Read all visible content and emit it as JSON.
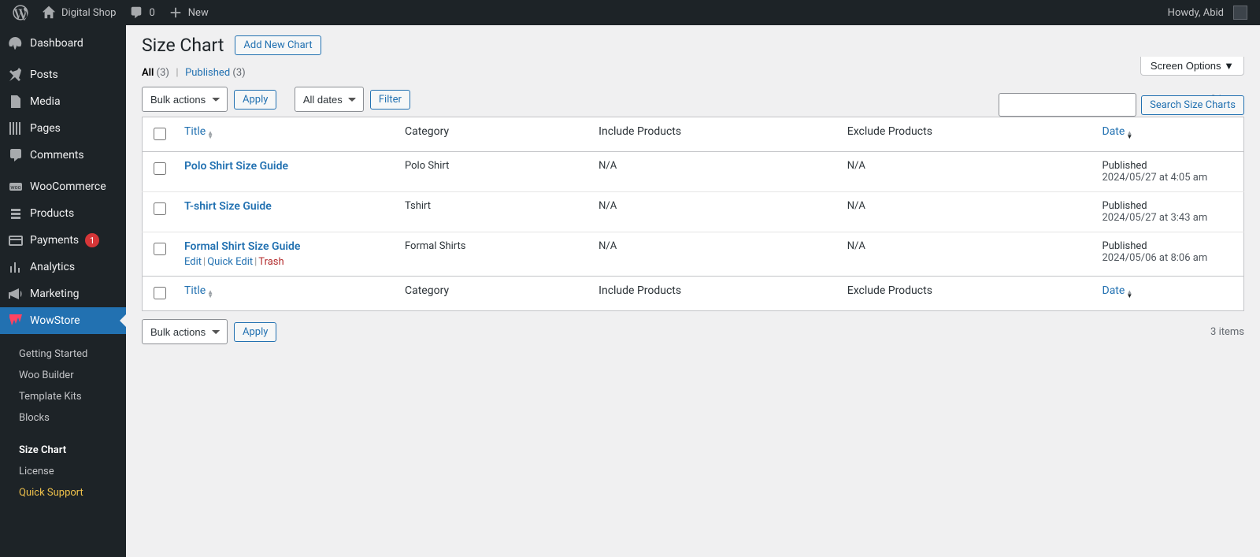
{
  "adminbar": {
    "site_name": "Digital Shop",
    "comments_count": "0",
    "new_label": "New",
    "howdy_label": "Howdy, Abid"
  },
  "sidebar": {
    "items": [
      {
        "icon": "dashboard",
        "label": "Dashboard"
      },
      {
        "icon": "pin",
        "label": "Posts"
      },
      {
        "icon": "media",
        "label": "Media"
      },
      {
        "icon": "page",
        "label": "Pages"
      },
      {
        "icon": "comment",
        "label": "Comments"
      },
      {
        "icon": "woo",
        "label": "WooCommerce"
      },
      {
        "icon": "products",
        "label": "Products"
      },
      {
        "icon": "payments",
        "label": "Payments",
        "badge": "1"
      },
      {
        "icon": "analytics",
        "label": "Analytics"
      },
      {
        "icon": "marketing",
        "label": "Marketing"
      },
      {
        "icon": "wowstore",
        "label": "WowStore",
        "active": true
      }
    ],
    "submenu": [
      {
        "label": "Getting Started"
      },
      {
        "label": "Woo Builder"
      },
      {
        "label": "Template Kits"
      },
      {
        "label": "Blocks"
      },
      {
        "label": "Size Chart",
        "current": true
      },
      {
        "label": "License"
      },
      {
        "label": "Quick Support",
        "gold": true
      }
    ]
  },
  "page": {
    "title": "Size Chart",
    "add_new_label": "Add New Chart",
    "screen_options_label": "Screen Options",
    "views_all_label": "All",
    "views_all_count": "(3)",
    "views_published_label": "Published",
    "views_published_count": "(3)",
    "bulk_actions_label": "Bulk actions",
    "apply_label": "Apply",
    "all_dates_label": "All dates",
    "filter_label": "Filter",
    "items_count_label": "3 items",
    "search_button_label": "Search Size Charts",
    "col_title": "Title",
    "col_category": "Category",
    "col_include": "Include Products",
    "col_exclude": "Exclude Products",
    "col_date": "Date",
    "row_action_edit": "Edit",
    "row_action_quick": "Quick Edit",
    "row_action_trash": "Trash",
    "published_word": "Published"
  },
  "rows": [
    {
      "title": "Polo Shirt Size Guide",
      "category": "Polo Shirt",
      "include": "N/A",
      "exclude": "N/A",
      "date": "2024/05/27 at 4:05 am"
    },
    {
      "title": "T-shirt Size Guide",
      "category": "Tshirt",
      "include": "N/A",
      "exclude": "N/A",
      "date": "2024/05/27 at 3:43 am"
    },
    {
      "title": "Formal Shirt Size Guide",
      "category": "Formal Shirts",
      "include": "N/A",
      "exclude": "N/A",
      "date": "2024/05/06 at 8:06 am",
      "show_actions": true
    }
  ]
}
